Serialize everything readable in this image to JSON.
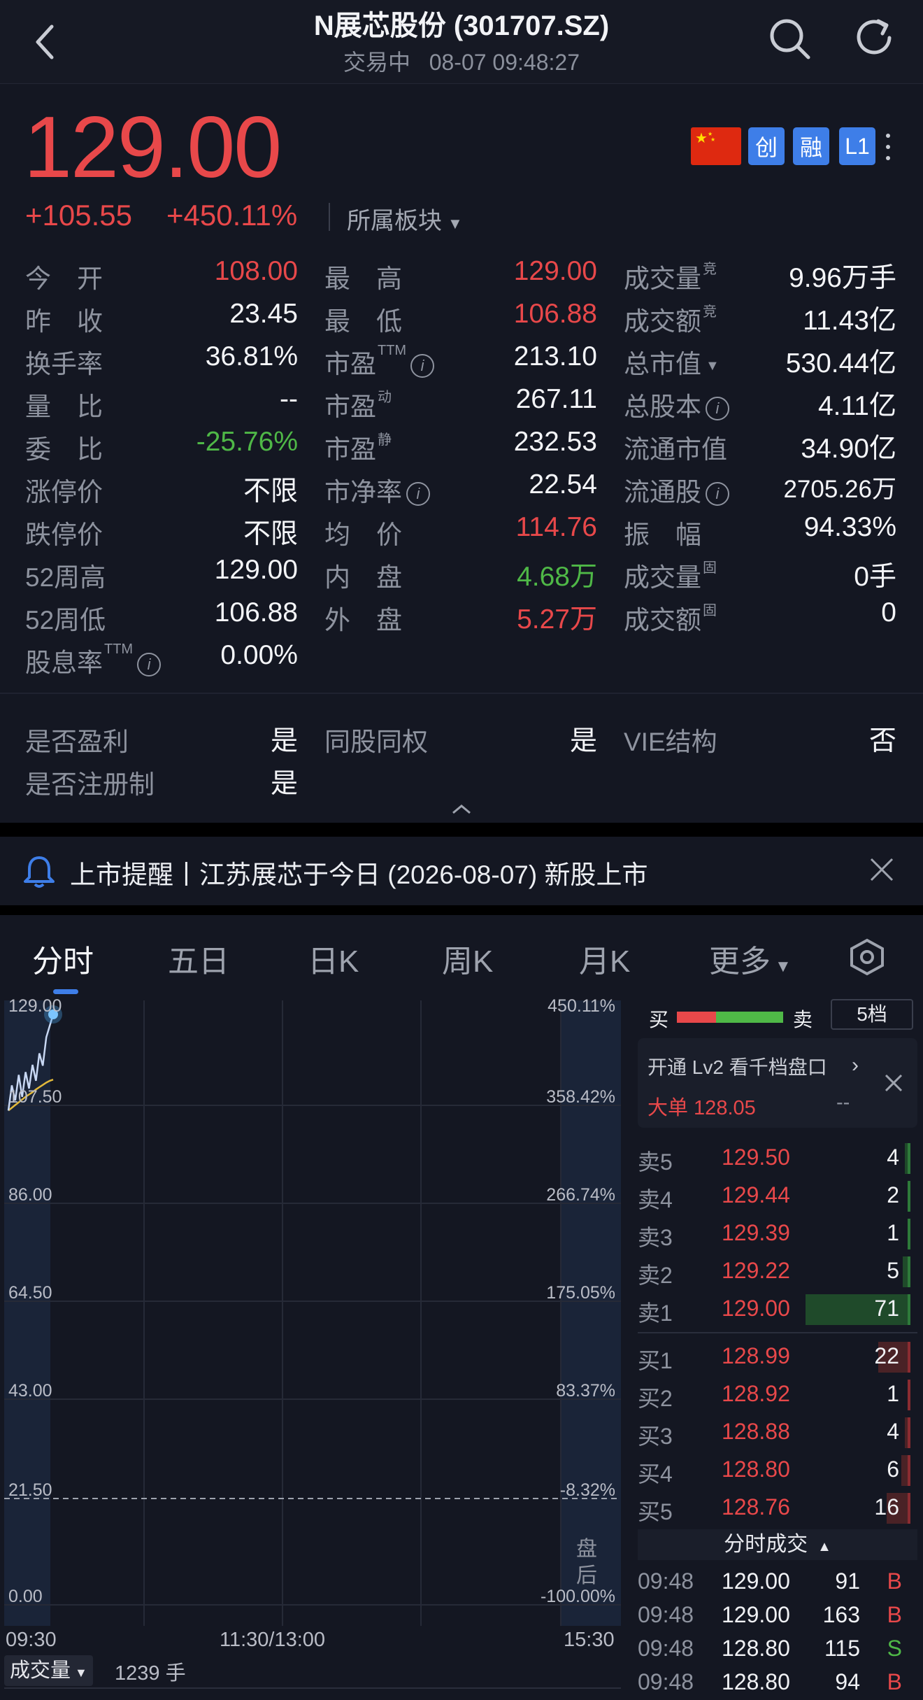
{
  "header": {
    "title": "N展芯股份 (301707.SZ)",
    "status": "交易中",
    "datetime": "08-07 09:48:27"
  },
  "quote": {
    "price": "129.00",
    "change": "+105.55",
    "change_pct": "+450.11%",
    "sector_label": "所属板块",
    "badges": [
      "创",
      "融",
      "L1"
    ]
  },
  "stats": {
    "col1": [
      {
        "label": "今　开",
        "value": "108.00",
        "color": "#e8484a"
      },
      {
        "label": "昨　收",
        "value": "23.45",
        "color": "#f4f5f8"
      },
      {
        "label": "换手率",
        "value": "36.81%",
        "color": "#f4f5f8"
      },
      {
        "label": "量　比",
        "value": "--",
        "color": "#f4f5f8"
      },
      {
        "label": "委　比",
        "value": "-25.76%",
        "color": "#4fb847"
      },
      {
        "label": "涨停价",
        "value": "不限",
        "color": "#f4f5f8"
      },
      {
        "label": "跌停价",
        "value": "不限",
        "color": "#f4f5f8"
      },
      {
        "label": "52周高",
        "value": "129.00",
        "color": "#f4f5f8"
      },
      {
        "label": "52周低",
        "value": "106.88",
        "color": "#f4f5f8"
      },
      {
        "label": "股息率",
        "value": "0.00%",
        "color": "#f4f5f8"
      }
    ],
    "col2": [
      {
        "label": "最　高",
        "value": "129.00",
        "color": "#e8484a"
      },
      {
        "label": "最　低",
        "value": "106.88",
        "color": "#e8484a"
      },
      {
        "label": "市盈",
        "value": "213.10",
        "color": "#f4f5f8"
      },
      {
        "label": "市盈",
        "value": "267.11",
        "color": "#f4f5f8"
      },
      {
        "label": "市盈",
        "value": "232.53",
        "color": "#f4f5f8"
      },
      {
        "label": "市净率",
        "value": "22.54",
        "color": "#f4f5f8"
      },
      {
        "label": "均　价",
        "value": "114.76",
        "color": "#e8484a"
      },
      {
        "label": "内　盘",
        "value": "4.68万",
        "color": "#4fb847"
      },
      {
        "label": "外　盘",
        "value": "5.27万",
        "color": "#e8484a"
      }
    ],
    "col3": [
      {
        "label": "成交量",
        "value": "9.96万手",
        "color": "#f4f5f8"
      },
      {
        "label": "成交额",
        "value": "11.43亿",
        "color": "#f4f5f8"
      },
      {
        "label": "总市值",
        "value": "530.44亿",
        "color": "#f4f5f8"
      },
      {
        "label": "总股本",
        "value": "4.11亿",
        "color": "#f4f5f8"
      },
      {
        "label": "流通市值",
        "value": "34.90亿",
        "color": "#f4f5f8"
      },
      {
        "label": "流通股",
        "value": "2705.26万",
        "color": "#f4f5f8"
      },
      {
        "label": "振　幅",
        "value": "94.33%",
        "color": "#f4f5f8"
      },
      {
        "label": "成交量",
        "value": "0手",
        "color": "#f4f5f8"
      },
      {
        "label": "成交额",
        "value": "0",
        "color": "#f4f5f8"
      }
    ],
    "ttm": "TTM",
    "dyn": "动",
    "stat": "静",
    "jing": "竞",
    "gu": "固"
  },
  "features": [
    {
      "label": "是否盈利",
      "value": "是"
    },
    {
      "label": "同股同权",
      "value": "是"
    },
    {
      "label": "VIE结构",
      "value": "否"
    },
    {
      "label": "是否注册制",
      "value": "是"
    }
  ],
  "notice": {
    "text": "上市提醒丨江苏展芯于今日 (2026-08-07) 新股上市"
  },
  "tabs": [
    "分时",
    "五日",
    "日K",
    "周K",
    "月K",
    "更多"
  ],
  "chart": {
    "left_labels": [
      "129.00",
      "107.50",
      "86.00",
      "64.50",
      "43.00",
      "21.50",
      "0.00"
    ],
    "right_labels": [
      "450.11%",
      "358.42%",
      "266.74%",
      "175.05%",
      "83.37%",
      "-8.32%",
      "-100.00%"
    ],
    "time_labels": [
      "09:30",
      "11:30/13:00",
      "15:30"
    ],
    "after_hours": "盘后",
    "volume_label": "成交量",
    "volume_value": "1239 手",
    "price_series": [
      108.0,
      113.5,
      110.2,
      115.8,
      111.0,
      116.4,
      112.8,
      118.0,
      114.5,
      120.5,
      117.8,
      124.0,
      126.5,
      129.0
    ],
    "avg_series": [
      108.0,
      108.6,
      109.2,
      109.8,
      110.4,
      111.0,
      111.5,
      112.0,
      112.6,
      113.1,
      113.6,
      114.1,
      114.5,
      114.76
    ]
  },
  "orderbook": {
    "buy_label": "买",
    "sell_label": "卖",
    "depth_button": "5档",
    "buy_ratio": 0.37,
    "promo_text": "开通 Lv2 看千档盘口",
    "big_order_label": "大单 128.05",
    "big_order_value": "--",
    "asks": [
      {
        "label": "卖5",
        "price": "129.50",
        "qty": "4"
      },
      {
        "label": "卖4",
        "price": "129.44",
        "qty": "2"
      },
      {
        "label": "卖3",
        "price": "129.39",
        "qty": "1"
      },
      {
        "label": "卖2",
        "price": "129.22",
        "qty": "5"
      },
      {
        "label": "卖1",
        "price": "129.00",
        "qty": "71"
      }
    ],
    "bids": [
      {
        "label": "买1",
        "price": "128.99",
        "qty": "22"
      },
      {
        "label": "买2",
        "price": "128.92",
        "qty": "1"
      },
      {
        "label": "买3",
        "price": "128.88",
        "qty": "4"
      },
      {
        "label": "买4",
        "price": "128.80",
        "qty": "6"
      },
      {
        "label": "买5",
        "price": "128.76",
        "qty": "16"
      }
    ],
    "ticks_title": "分时成交",
    "ticks": [
      {
        "time": "09:48",
        "price": "129.00",
        "qty": "91",
        "side": "B"
      },
      {
        "time": "09:48",
        "price": "129.00",
        "qty": "163",
        "side": "B"
      },
      {
        "time": "09:48",
        "price": "128.80",
        "qty": "115",
        "side": "S"
      },
      {
        "time": "09:48",
        "price": "128.80",
        "qty": "94",
        "side": "B"
      }
    ]
  }
}
